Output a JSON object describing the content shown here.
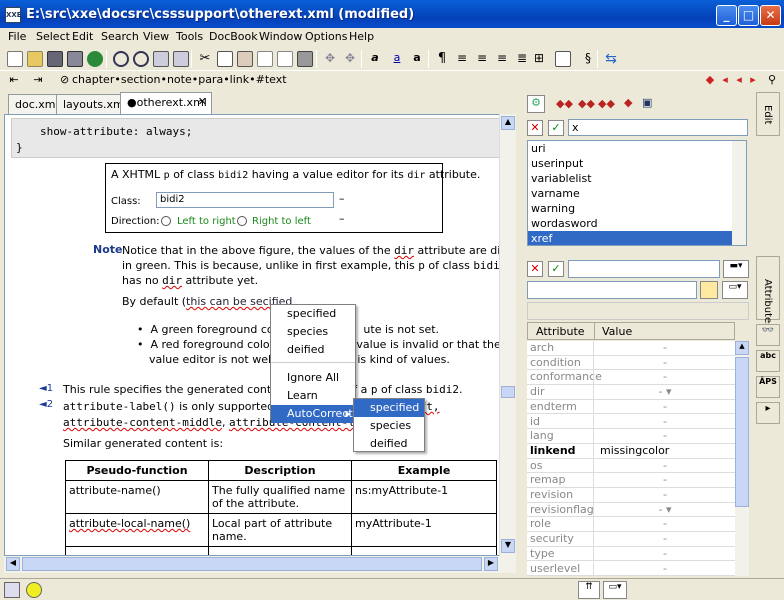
{
  "window": {
    "title": "E:\\src\\xxe\\docsrc\\csssupport\\otherext.xml (modified)"
  },
  "menu": [
    "File",
    "Select",
    "Edit",
    "Search",
    "View",
    "Tools",
    "DocBook",
    "Window",
    "Options",
    "Help"
  ],
  "breadcrumb": "chapter•section•note•para•link•#text",
  "tabs": [
    "doc.xml",
    "layouts.xml",
    "●otherext.xml"
  ],
  "doc": {
    "code_line": "show-attribute: always;",
    "code_brace": "}",
    "figure": {
      "caption_pre": "A XHTML ",
      "caption_p": "p",
      "caption_mid": " of class ",
      "caption_class": "bidi2",
      "caption_post": " having a value editor for its ",
      "caption_dir": "dir",
      "caption_end": " attribute.",
      "class_label": "Class:",
      "class_value": "bidi2",
      "direction_label": "Direction:",
      "radio1": "Left to right",
      "radio2": "Right to left",
      "dash": "–"
    },
    "note_label": "Note",
    "note_line1a": "Notice that in the above figure, the values of the ",
    "note_dir": "dir",
    "note_line1b": " attribute are displayed",
    "note_line2a": "in green. This is because, unlike in first example, this ",
    "note_p": "p",
    "note_line2b": " of class ",
    "note_bidi2": "bidi2",
    "note_line3a": "has no ",
    "note_dir2": "dir",
    "note_line3b": " attribute yet.",
    "default_pre": "By default (",
    "default_link": "this can be secified",
    "bullet1a": "A green foreground colo",
    "bullet1b": "ute is not set.",
    "bullet2a": "A red foreground color m",
    "bullet2b": "value is invalid or that the",
    "bullet3a": "value editor is not well s",
    "bullet3b": "is kind of values.",
    "rule1_num": "◄1",
    "rule1a": "This rule specifies the generated content",
    "rule1b": "f a ",
    "rule1_p": "p",
    "rule1c": " of class ",
    "rule1_bidi2": "bidi2",
    "rule1d": ".",
    "rule2_num": "◄2",
    "rule2_code": "attribute-label()",
    "rule2b": " is only supported in",
    "rule2_tail": "ft,",
    "rule2_line2a": "attribute-content-middle",
    "rule2_line2b": ", ",
    "rule2_line2c": "attribute-content-li",
    "similar": "Similar generated content is:",
    "table": {
      "headers": [
        "Pseudo-function",
        "Description",
        "Example"
      ],
      "rows": [
        [
          "attribute-name()",
          "The fully qualified name of the attribute.",
          "ns:myAttribute-1"
        ],
        [
          "attribute-local-name()",
          "Local part of attribute name.",
          "myAttribute-1"
        ]
      ]
    }
  },
  "context_menu": {
    "items": [
      "specified",
      "species",
      "deified",
      "Ignore All",
      "Learn",
      "AutoCorrect"
    ],
    "submenu": [
      "specified",
      "species",
      "deified"
    ]
  },
  "right_top": {
    "filter_value": "x",
    "list": [
      "uri",
      "userinput",
      "variablelist",
      "varname",
      "warning",
      "wordasword",
      "xref"
    ],
    "selected": "xref"
  },
  "attributes": {
    "col_attr": "Attribute",
    "col_value": "Value",
    "rows": [
      {
        "name": "arch",
        "value": "-"
      },
      {
        "name": "condition",
        "value": "-"
      },
      {
        "name": "conformance",
        "value": "-"
      },
      {
        "name": "dir",
        "value": "- ▾"
      },
      {
        "name": "endterm",
        "value": "-"
      },
      {
        "name": "id",
        "value": "-"
      },
      {
        "name": "lang",
        "value": "-"
      },
      {
        "name": "linkend",
        "value": "missingcolor"
      },
      {
        "name": "os",
        "value": "-"
      },
      {
        "name": "remap",
        "value": "-"
      },
      {
        "name": "revision",
        "value": "-"
      },
      {
        "name": "revisionflag",
        "value": "- ▾"
      },
      {
        "name": "role",
        "value": "-"
      },
      {
        "name": "security",
        "value": "-"
      },
      {
        "name": "type",
        "value": "-"
      },
      {
        "name": "userlevel",
        "value": "-"
      }
    ]
  },
  "side_tabs": {
    "edit": "Edit",
    "attributes": "Attributes"
  }
}
